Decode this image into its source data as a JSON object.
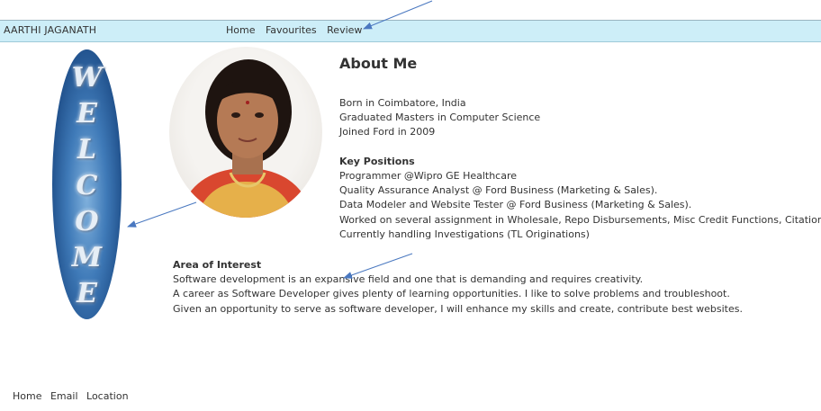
{
  "header": {
    "brand": "AARTHI JAGANATH",
    "nav": [
      "Home",
      "Favourites",
      "Review"
    ]
  },
  "welcome": {
    "letters": [
      "W",
      "E",
      "L",
      "C",
      "O",
      "M",
      "E"
    ]
  },
  "about": {
    "title": "About Me",
    "bio": [
      "Born in Coimbatore, India",
      "Graduated Masters in Computer Science",
      "Joined Ford in 2009"
    ],
    "key_positions_heading": "Key Positions",
    "key_positions": [
      "Programmer @Wipro GE Healthcare",
      "Quality Assurance Analyst @ Ford Business (Marketing & Sales).",
      "Data Modeler and Website Tester @ Ford Business (Marketing & Sales).",
      "Worked on several assignment in Wholesale, Repo Disbursements, Misc Credit Functions, Citations.",
      "Currently handling Investigations (TL Originations)"
    ]
  },
  "interest": {
    "heading": "Area of Interest",
    "lines": [
      "Software development is an expansive field and one that is demanding and requires creativity.",
      "A career as Software Developer gives plenty of learning opportunities. I like to solve problems and troubleshoot.",
      "Given an opportunity to serve as software developer, I will enhance my skills and create, contribute best websites."
    ]
  },
  "footer": {
    "links": [
      "Home",
      "Email",
      "Location"
    ]
  },
  "colors": {
    "navbar_bg": "#cdeef8",
    "welcome_blue": "#2f63a0",
    "arrow": "#4a78c0"
  }
}
